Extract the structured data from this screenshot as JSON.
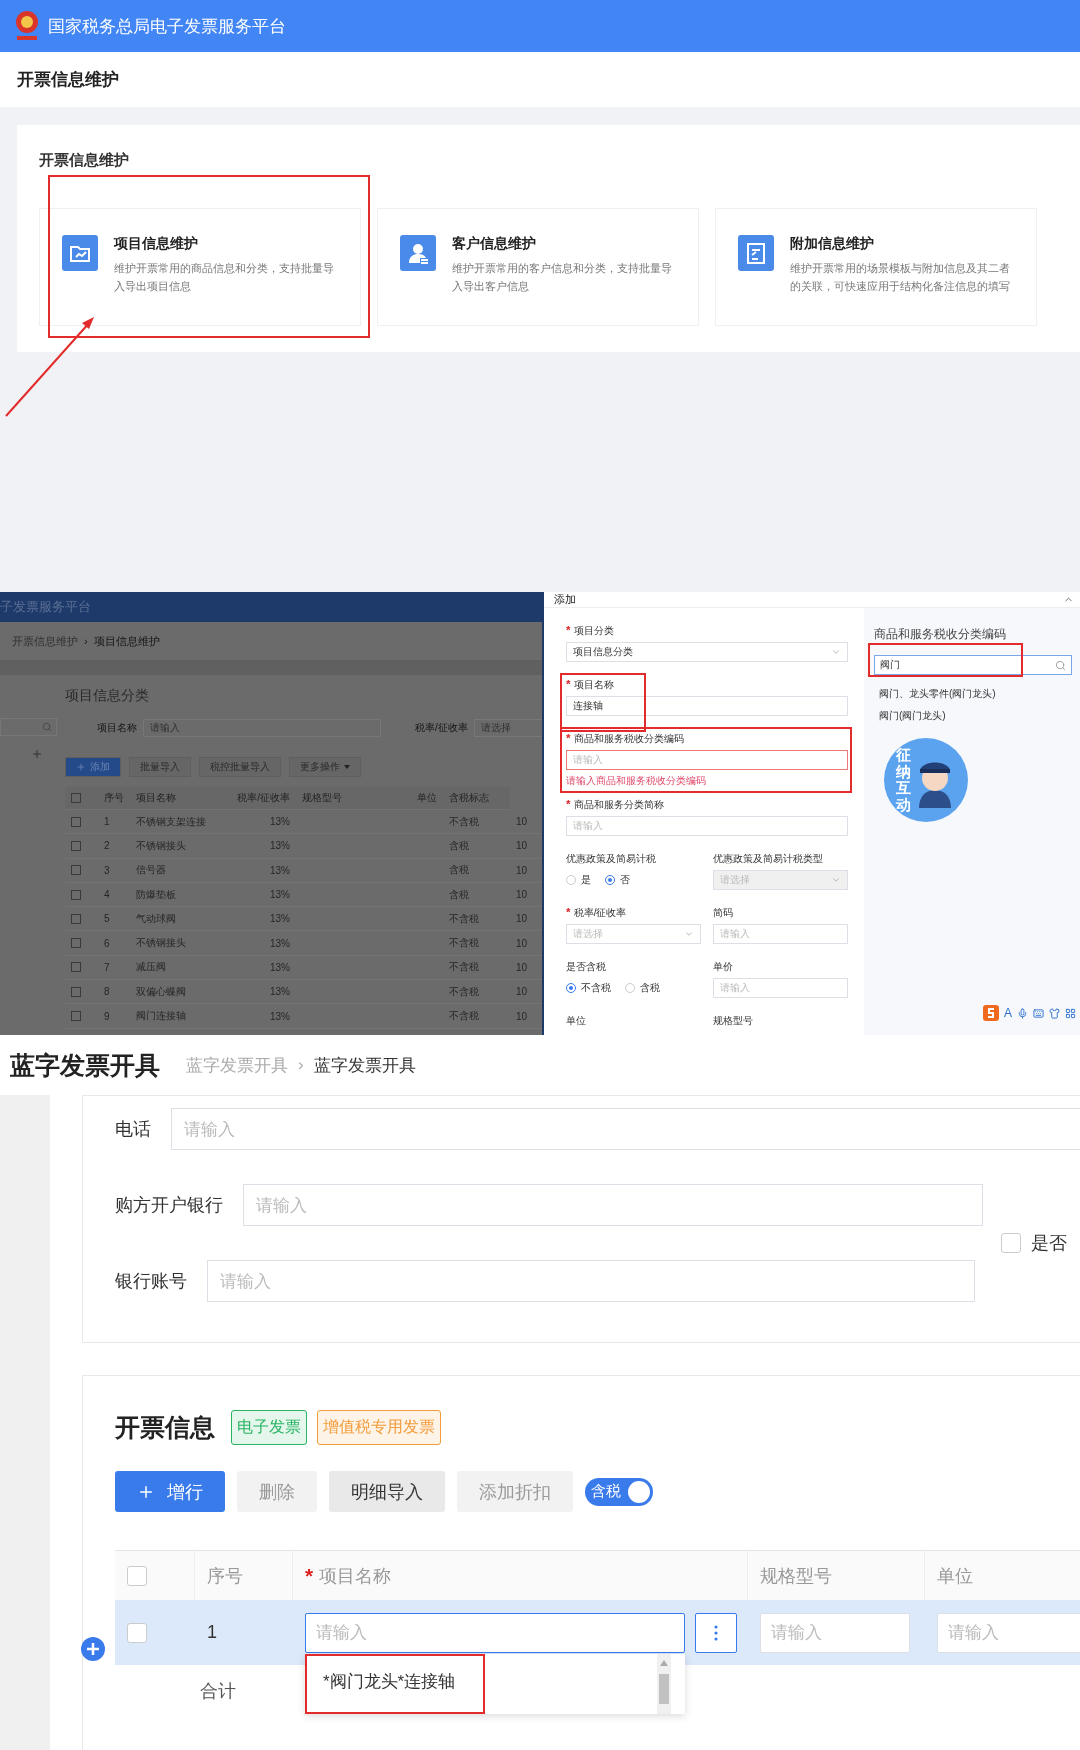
{
  "maintenance_screen": {
    "platform_title": "国家税务总局电子发票服务平台",
    "page_title": "开票信息维护",
    "panel_title": "开票信息维护",
    "cards": [
      {
        "kind": "folder",
        "title": "项目信息维护",
        "desc": "维护开票常用的商品信息和分类，支持批量导入导出项目信息",
        "highlighted": true
      },
      {
        "kind": "user",
        "title": "客户信息维护",
        "desc": "维护开票常用的客户信息和分类，支持批量导入导出客户信息",
        "highlighted": false
      },
      {
        "kind": "document",
        "title": "附加信息维护",
        "desc": "维护开票常用的场景模板与附加信息及其二者的关联，可快速应用于结构化备注信息的填写",
        "highlighted": false
      }
    ]
  },
  "item_list_screen": {
    "header_fragment": "子发票服务平台",
    "breadcrumb": [
      "开票信息维护",
      "项目信息维护"
    ],
    "breadcrumb_separator": "›",
    "section_title": "项目信息分类",
    "select_all_checked": false,
    "filters": [
      {
        "label": "项目名称",
        "placeholder": "请输入"
      },
      {
        "label": "税率/征收率",
        "placeholder": "请选择"
      }
    ],
    "buttons": [
      {
        "label": "添加",
        "kind": "primary"
      },
      {
        "label": "批量导入",
        "kind": "default"
      },
      {
        "label": "税控批量导入",
        "kind": "default"
      },
      {
        "label": "更多操作",
        "kind": "dropdown"
      }
    ],
    "columns": [
      "序号",
      "项目名称",
      "税率/征收率",
      "规格型号",
      "单位",
      "含税标志"
    ],
    "rows": [
      {
        "no": "1",
        "checked": false,
        "name": "不锈钢支架连接",
        "rate": "13%",
        "tax": "不含税",
        "column_7": "10"
      },
      {
        "no": "2",
        "checked": false,
        "name": "不锈钢接头",
        "rate": "13%",
        "tax": "含税",
        "column_7": "10"
      },
      {
        "no": "3",
        "checked": false,
        "name": "信号器",
        "rate": "13%",
        "tax": "含税",
        "column_7": "10"
      },
      {
        "no": "4",
        "checked": false,
        "name": "防爆垫板",
        "rate": "13%",
        "tax": "含税",
        "column_7": "10"
      },
      {
        "no": "5",
        "checked": false,
        "name": "气动球阀",
        "rate": "13%",
        "tax": "不含税",
        "column_7": "10"
      },
      {
        "no": "6",
        "checked": false,
        "name": "不锈钢接头",
        "rate": "13%",
        "tax": "不含税",
        "column_7": "10"
      },
      {
        "no": "7",
        "checked": false,
        "name": "减压阀",
        "rate": "13%",
        "tax": "不含税",
        "column_7": "10"
      },
      {
        "no": "8",
        "checked": false,
        "name": "双偏心蝶阀",
        "rate": "13%",
        "tax": "不含税",
        "column_7": "10"
      },
      {
        "no": "9",
        "checked": false,
        "name": "阀门连接轴",
        "rate": "13%",
        "tax": "不含税",
        "column_7": "10"
      }
    ]
  },
  "add_dialog": {
    "title": "添加",
    "required_mark": "*",
    "form_rows": [
      [
        {
          "kind": "select",
          "label": "项目分类",
          "required": true,
          "value": "项目信息分类",
          "disabled": false,
          "highlighted": false
        }
      ],
      [
        {
          "kind": "input",
          "label": "项目名称",
          "required": true,
          "value": "连接轴",
          "highlighted": true
        }
      ],
      [
        {
          "kind": "input",
          "label": "商品和服务税收分类编码",
          "required": true,
          "placeholder": "请输入",
          "error": "请输入商品和服务税收分类编码",
          "highlighted": true
        }
      ],
      [
        {
          "kind": "input",
          "label": "商品和服务分类简称",
          "required": true,
          "placeholder": "请输入",
          "highlighted": false
        }
      ],
      [
        {
          "kind": "radio",
          "label": "优惠政策及简易计税",
          "required": false,
          "options": [
            {
              "label": "是",
              "selected": false
            },
            {
              "label": "否",
              "selected": true
            }
          ],
          "highlighted": false
        },
        {
          "kind": "select",
          "label": "优惠政策及简易计税类型",
          "required": false,
          "placeholder": "请选择",
          "disabled": true,
          "highlighted": false
        }
      ],
      [
        {
          "kind": "select",
          "label": "税率/征收率",
          "required": true,
          "placeholder": "请选择",
          "disabled": false,
          "highlighted": false
        },
        {
          "kind": "input",
          "label": "简码",
          "required": false,
          "placeholder": "请输入",
          "highlighted": false
        }
      ],
      [
        {
          "kind": "radio",
          "label": "是否含税",
          "required": false,
          "options": [
            {
              "label": "不含税",
              "selected": true
            },
            {
              "label": "含税",
              "selected": false
            }
          ],
          "highlighted": false
        },
        {
          "kind": "input",
          "label": "单价",
          "required": false,
          "placeholder": "请输入",
          "highlighted": false
        }
      ],
      [
        {
          "kind": "cut",
          "label": "单位",
          "required": false
        },
        {
          "kind": "cut",
          "label": "规格型号",
          "required": false
        }
      ]
    ],
    "code_panel": {
      "title": "商品和服务税收分类编码",
      "search_value": "阀门",
      "highlighted": true,
      "results": [
        "阀门、龙头零件(阀门龙头)",
        "阀门(阀门龙头)"
      ]
    },
    "assistant_badge": "征纳互动",
    "ime_letter": "A"
  },
  "invoice_screen": {
    "title": "蓝字发票开具",
    "breadcrumb": [
      "蓝字发票开具",
      "蓝字发票开具"
    ],
    "breadcrumb_separator": "›",
    "required_mark": "*",
    "select_all_checked": false,
    "buyer_fields": [
      {
        "label": "电话",
        "placeholder": "请输入"
      },
      {
        "label": "购方开户银行",
        "placeholder": "请输入"
      },
      {
        "label": "银行账号",
        "placeholder": "请输入"
      }
    ],
    "show_checkbox": {
      "label": "是否",
      "checked": false
    },
    "section_title": "开票信息",
    "tags": [
      {
        "label": "电子发票",
        "color": "#28b463"
      },
      {
        "label": "增值税专用发票",
        "color": "#f39c3c"
      }
    ],
    "buttons": [
      {
        "label": "增行",
        "kind": "primary",
        "disabled": false
      },
      {
        "label": "删除",
        "kind": "default",
        "disabled": true
      },
      {
        "label": "明细导入",
        "kind": "default",
        "disabled": false
      },
      {
        "label": "添加折扣",
        "kind": "default",
        "disabled": true
      }
    ],
    "tax_toggle": {
      "label": "含税",
      "on": true
    },
    "columns": [
      {
        "label": "序号",
        "required": false
      },
      {
        "label": "项目名称",
        "required": true
      },
      {
        "label": "规格型号",
        "required": false
      },
      {
        "label": "单位",
        "required": false
      }
    ],
    "rows": [
      {
        "no": "1",
        "checked": false,
        "name_placeholder": "请输入",
        "spec_placeholder": "请输入",
        "unit_placeholder": "请输入"
      }
    ],
    "total_label": "合计",
    "suggestions": [
      {
        "label": "*阀门龙头*连接轴",
        "highlighted": true
      }
    ]
  }
}
